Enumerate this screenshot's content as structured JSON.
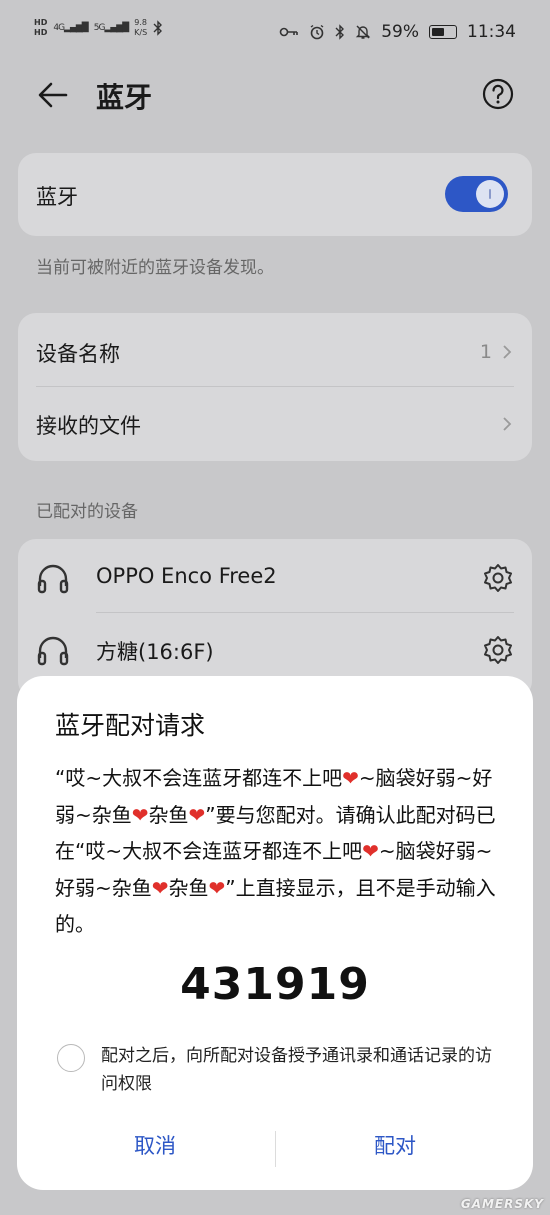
{
  "status_bar": {
    "hd_top": "HD",
    "hd_bottom": "HD",
    "signal_1": "4G",
    "signal_2": "5G",
    "speed_value": "9.8",
    "speed_unit": "K/S",
    "battery": "59%",
    "battery_level": 0.59,
    "time": "11:34",
    "icons": [
      "key-icon",
      "alarm-icon",
      "bluetooth-icon",
      "mute-icon",
      "battery-icon"
    ]
  },
  "header": {
    "title": "蓝牙"
  },
  "bluetooth": {
    "label": "蓝牙",
    "enabled": true,
    "hint": "当前可被附近的蓝牙设备发现。"
  },
  "settings": {
    "device_name_label": "设备名称",
    "device_name_value": "1",
    "received_files_label": "接收的文件"
  },
  "paired": {
    "section_title": "已配对的设备",
    "devices": [
      {
        "name": "OPPO Enco Free2"
      },
      {
        "name": "方糖(16:6F)"
      }
    ]
  },
  "dialog": {
    "title": "蓝牙配对请求",
    "message_segments": [
      "“哎~大叔不会连蓝牙都连不上吧",
      "❤",
      "~脑袋好弱~好弱~杂鱼",
      "❤",
      "杂鱼",
      "❤",
      "”要与您配对。请确认此配对码已在“哎~大叔不会连蓝牙都连不上吧",
      "❤",
      "~脑袋好弱~好弱~杂鱼",
      "❤",
      "杂鱼",
      "❤",
      "”上直接显示，且不是手动输入的。"
    ],
    "pin": "431919",
    "checkbox_label": "配对之后，向所配对设备授予通讯录和通话记录的访问权限",
    "checkbox_checked": false,
    "cancel_label": "取消",
    "pair_label": "配对"
  },
  "watermark": "GAMERSKY",
  "colors": {
    "accent": "#2d57c6",
    "heart": "#e0302b",
    "background": "#c8c8ca",
    "card": "#d8d8da"
  }
}
